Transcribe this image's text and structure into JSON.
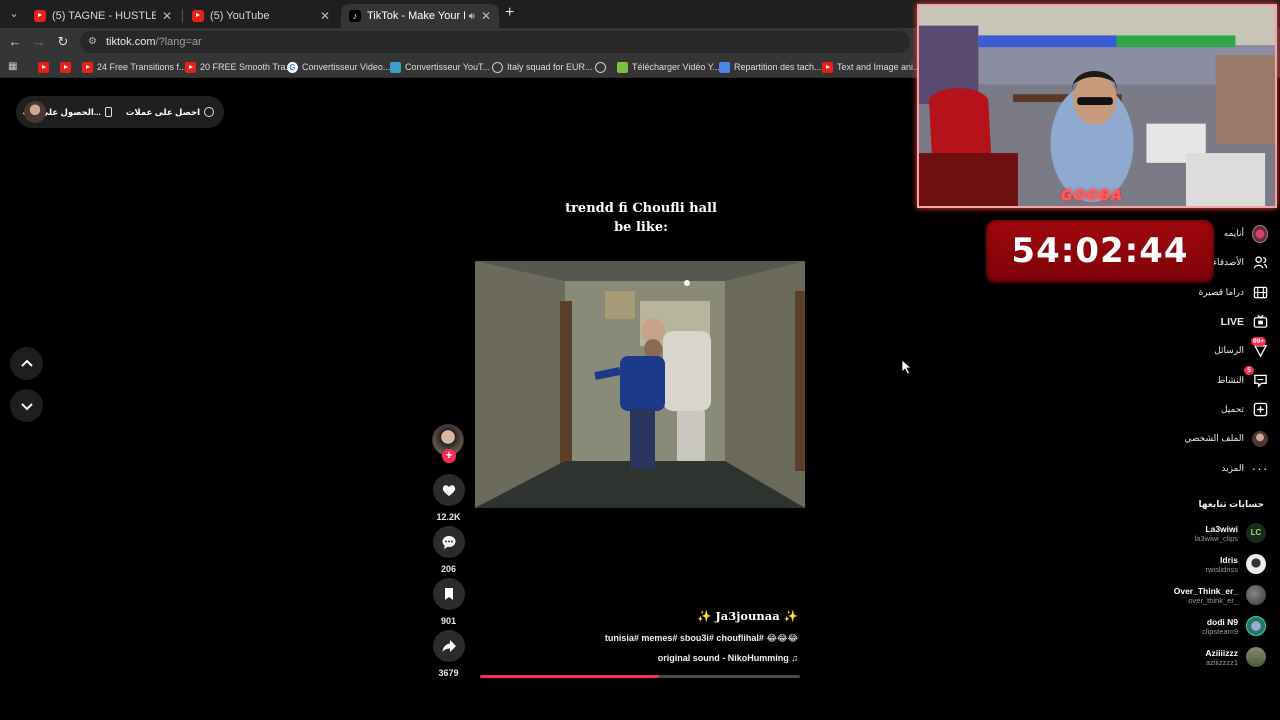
{
  "browser": {
    "tabs": [
      {
        "title": "(5) TAGNE - HUSTLER ft. A.L.A (",
        "favicon": "youtube",
        "active": false
      },
      {
        "title": "(5) YouTube",
        "favicon": "youtube",
        "active": false
      },
      {
        "title": "TikTok - Make Your Day",
        "favicon": "tiktok",
        "active": true,
        "audio": true
      }
    ],
    "url_domain": "tiktok.com",
    "url_path": "/?lang=ar",
    "bookmarks": [
      {
        "label": "",
        "icon": "youtube"
      },
      {
        "label": "",
        "icon": "youtube"
      },
      {
        "label": "24 Free Transitions f...",
        "icon": "youtube"
      },
      {
        "label": "20 FREE Smooth Tra...",
        "icon": "youtube"
      },
      {
        "label": "Convertisseur Video...",
        "icon": "google"
      },
      {
        "label": "Convertisseur YouT...",
        "icon": "converter"
      },
      {
        "label": "Italy squad for EUR...",
        "icon": "globe"
      },
      {
        "label": "",
        "icon": "globe"
      },
      {
        "label": "Télécharger Vidéo Y...",
        "icon": "download"
      },
      {
        "label": "Repartition des tach...",
        "icon": "docs"
      },
      {
        "label": "Text and Image ani...",
        "icon": "youtube"
      }
    ]
  },
  "top_actions": {
    "get_coins": "احصل على عملات",
    "get_app": "الحصول على الت..."
  },
  "post": {
    "caption_line1": "trendd fi Choufli hall",
    "caption_line2": "be like:",
    "username": "✨ Ja3jounaa ✨",
    "description": "tunisia# memes# sbou3i# chouflihal# 😂😂😂",
    "sound": "original sound - NikoHumming ♫",
    "progress": 0.56,
    "likes": "12.2K",
    "comments": "206",
    "bookmarks": "901",
    "shares": "3679"
  },
  "sidebar": {
    "items": [
      {
        "label": "أنايمه",
        "icon": "avatar-icon"
      },
      {
        "label": "الأصدقاء",
        "icon": "friends-icon"
      },
      {
        "label": "دراما قصيرة",
        "icon": "film-icon"
      },
      {
        "label": "LIVE",
        "icon": "live-tv-icon"
      },
      {
        "label": "الرسائل",
        "icon": "inbox-icon",
        "badge": "99+"
      },
      {
        "label": "النشاط",
        "icon": "activity-icon",
        "badge": "5"
      },
      {
        "label": "تحميل",
        "icon": "upload-icon"
      },
      {
        "label": "الملف الشخصي",
        "icon": "profile-avatar-icon"
      },
      {
        "label": "المزيد",
        "icon": "more-icon"
      }
    ],
    "following_title": "حسابات تتابعها",
    "following": [
      {
        "name": "La3wiwi",
        "handle": "la3wiwi_clips",
        "color": "#1a2a1a"
      },
      {
        "name": "Idris",
        "handle": "rwislidriss",
        "color": "#e8e8e8"
      },
      {
        "name": "Over_Think_er_",
        "handle": "over_think_er_",
        "color": "#555555"
      },
      {
        "name": "dodi N9",
        "handle": "clipsteam9",
        "color": "#2a7a5a"
      },
      {
        "name": "Aziiiizzz",
        "handle": "aziiizzzz1",
        "color": "#6a6a50"
      }
    ]
  },
  "overlay": {
    "timer": "54:02:44",
    "cam_logo": "GOOBA"
  },
  "colors": {
    "accent": "#fe2c55",
    "timer_bg": "#9a060c"
  }
}
